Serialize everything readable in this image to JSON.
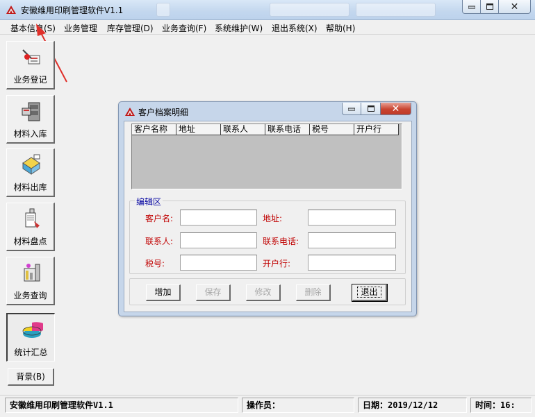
{
  "window": {
    "title": "安徽维用印刷管理软件V1.1",
    "min_symbol": "▭",
    "max_symbol": "□",
    "close_symbol": "✕"
  },
  "menu": [
    {
      "label": "基本信息(S)"
    },
    {
      "label": "业务管理"
    },
    {
      "label": "库存管理(D)"
    },
    {
      "label": "业务查询(F)"
    },
    {
      "label": "系统维护(W)"
    },
    {
      "label": "退出系统(X)"
    },
    {
      "label": "帮助(H)"
    }
  ],
  "toolbar": {
    "items": [
      {
        "label": "业务登记",
        "icon": "business-register-icon"
      },
      {
        "label": "材料入库",
        "icon": "stock-in-icon"
      },
      {
        "label": "材料出库",
        "icon": "stock-out-icon"
      },
      {
        "label": "材料盘点",
        "icon": "inventory-check-icon"
      },
      {
        "label": "业务查询",
        "icon": "business-query-icon"
      },
      {
        "label": "统计汇总",
        "icon": "statistics-icon"
      }
    ],
    "background_label": "背景(B)"
  },
  "dialog": {
    "title": "客户档案明细",
    "columns": [
      "客户名称",
      "地址",
      "联系人",
      "联系电话",
      "税号",
      "开户行"
    ],
    "edit_group": "编辑区",
    "fields": {
      "customer_name": {
        "label": "客户名:",
        "value": ""
      },
      "address": {
        "label": "地址:",
        "value": ""
      },
      "contact": {
        "label": "联系人:",
        "value": ""
      },
      "phone": {
        "label": "联系电话:",
        "value": ""
      },
      "tax_no": {
        "label": "税号:",
        "value": ""
      },
      "bank": {
        "label": "开户行:",
        "value": ""
      }
    },
    "buttons": {
      "add": "增加",
      "save": "保存",
      "edit": "修改",
      "delete": "删除",
      "exit": "退出"
    }
  },
  "status": {
    "app": "安徽维用印刷管理软件V1.1",
    "operator": "操作员：",
    "date": "日期：2019/12/12",
    "time": "时间：16:"
  },
  "colors": {
    "label_red": "#c00000",
    "group_blue": "#0000a0",
    "arrow_red": "#e0302a"
  }
}
